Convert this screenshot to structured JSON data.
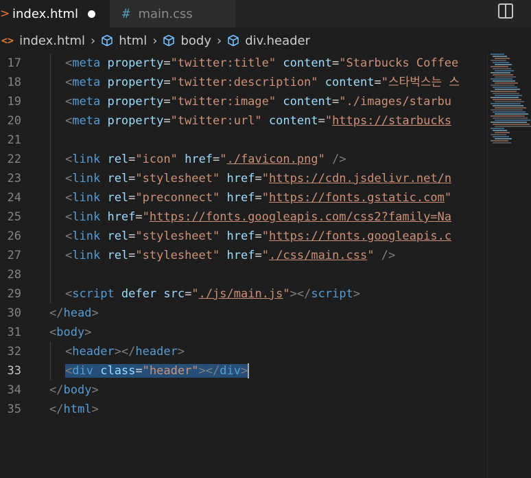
{
  "tabs": [
    {
      "label": "index.html",
      "icon": "html-chevron-icon",
      "active": true,
      "modified": true
    },
    {
      "label": "main.css",
      "icon": "hash-icon",
      "active": false
    }
  ],
  "breadcrumb": [
    "index.html",
    "html",
    "body",
    "div.header"
  ],
  "code_lines": [
    {
      "n": "17",
      "indent": 2,
      "tokens": [
        [
          "p",
          "<"
        ],
        [
          "tag",
          "meta"
        ],
        [
          "sp",
          " "
        ],
        [
          "attr",
          "property"
        ],
        [
          "eq",
          "="
        ],
        [
          "str",
          "\"twitter:title\""
        ],
        [
          "sp",
          " "
        ],
        [
          "attr",
          "content"
        ],
        [
          "eq",
          "="
        ],
        [
          "str",
          "\"Starbucks Coffee"
        ]
      ]
    },
    {
      "n": "18",
      "indent": 2,
      "tokens": [
        [
          "p",
          "<"
        ],
        [
          "tag",
          "meta"
        ],
        [
          "sp",
          " "
        ],
        [
          "attr",
          "property"
        ],
        [
          "eq",
          "="
        ],
        [
          "str",
          "\"twitter:description\""
        ],
        [
          "sp",
          " "
        ],
        [
          "attr",
          "content"
        ],
        [
          "eq",
          "="
        ],
        [
          "str",
          "\"스타벅스는 스"
        ]
      ]
    },
    {
      "n": "19",
      "indent": 2,
      "tokens": [
        [
          "p",
          "<"
        ],
        [
          "tag",
          "meta"
        ],
        [
          "sp",
          " "
        ],
        [
          "attr",
          "property"
        ],
        [
          "eq",
          "="
        ],
        [
          "str",
          "\"twitter:image\""
        ],
        [
          "sp",
          " "
        ],
        [
          "attr",
          "content"
        ],
        [
          "eq",
          "="
        ],
        [
          "str",
          "\"./images/starbu"
        ]
      ]
    },
    {
      "n": "20",
      "indent": 2,
      "tokens": [
        [
          "p",
          "<"
        ],
        [
          "tag",
          "meta"
        ],
        [
          "sp",
          " "
        ],
        [
          "attr",
          "property"
        ],
        [
          "eq",
          "="
        ],
        [
          "str",
          "\"twitter:url\""
        ],
        [
          "sp",
          " "
        ],
        [
          "attr",
          "content"
        ],
        [
          "eq",
          "="
        ],
        [
          "str",
          "\""
        ],
        [
          "url",
          "https://starbucks"
        ]
      ]
    },
    {
      "n": "21",
      "indent": 2,
      "tokens": []
    },
    {
      "n": "22",
      "indent": 2,
      "tokens": [
        [
          "p",
          "<"
        ],
        [
          "tag",
          "link"
        ],
        [
          "sp",
          " "
        ],
        [
          "attr",
          "rel"
        ],
        [
          "eq",
          "="
        ],
        [
          "str",
          "\"icon\""
        ],
        [
          "sp",
          " "
        ],
        [
          "attr",
          "href"
        ],
        [
          "eq",
          "="
        ],
        [
          "str",
          "\""
        ],
        [
          "url",
          "./favicon.png"
        ],
        [
          "str",
          "\""
        ],
        [
          "sp",
          " "
        ],
        [
          "p",
          "/>"
        ]
      ]
    },
    {
      "n": "23",
      "indent": 2,
      "tokens": [
        [
          "p",
          "<"
        ],
        [
          "tag",
          "link"
        ],
        [
          "sp",
          " "
        ],
        [
          "attr",
          "rel"
        ],
        [
          "eq",
          "="
        ],
        [
          "str",
          "\"stylesheet\""
        ],
        [
          "sp",
          " "
        ],
        [
          "attr",
          "href"
        ],
        [
          "eq",
          "="
        ],
        [
          "str",
          "\""
        ],
        [
          "url",
          "https://cdn.jsdelivr.net/n"
        ]
      ]
    },
    {
      "n": "24",
      "indent": 2,
      "tokens": [
        [
          "p",
          "<"
        ],
        [
          "tag",
          "link"
        ],
        [
          "sp",
          " "
        ],
        [
          "attr",
          "rel"
        ],
        [
          "eq",
          "="
        ],
        [
          "str",
          "\"preconnect\""
        ],
        [
          "sp",
          " "
        ],
        [
          "attr",
          "href"
        ],
        [
          "eq",
          "="
        ],
        [
          "str",
          "\""
        ],
        [
          "url",
          "https://fonts.gstatic.com"
        ],
        [
          "str",
          "\""
        ]
      ]
    },
    {
      "n": "25",
      "indent": 2,
      "tokens": [
        [
          "p",
          "<"
        ],
        [
          "tag",
          "link"
        ],
        [
          "sp",
          " "
        ],
        [
          "attr",
          "href"
        ],
        [
          "eq",
          "="
        ],
        [
          "str",
          "\""
        ],
        [
          "url",
          "https://fonts.googleapis.com/css2?family=Na"
        ]
      ]
    },
    {
      "n": "26",
      "indent": 2,
      "tokens": [
        [
          "p",
          "<"
        ],
        [
          "tag",
          "link"
        ],
        [
          "sp",
          " "
        ],
        [
          "attr",
          "rel"
        ],
        [
          "eq",
          "="
        ],
        [
          "str",
          "\"stylesheet\""
        ],
        [
          "sp",
          " "
        ],
        [
          "attr",
          "href"
        ],
        [
          "eq",
          "="
        ],
        [
          "str",
          "\""
        ],
        [
          "url",
          "https://fonts.googleapis.c"
        ]
      ]
    },
    {
      "n": "27",
      "indent": 2,
      "tokens": [
        [
          "p",
          "<"
        ],
        [
          "tag",
          "link"
        ],
        [
          "sp",
          " "
        ],
        [
          "attr",
          "rel"
        ],
        [
          "eq",
          "="
        ],
        [
          "str",
          "\"stylesheet\""
        ],
        [
          "sp",
          " "
        ],
        [
          "attr",
          "href"
        ],
        [
          "eq",
          "="
        ],
        [
          "str",
          "\""
        ],
        [
          "url",
          "./css/main.css"
        ],
        [
          "str",
          "\""
        ],
        [
          "sp",
          " "
        ],
        [
          "p",
          "/>"
        ]
      ]
    },
    {
      "n": "28",
      "indent": 2,
      "tokens": []
    },
    {
      "n": "29",
      "indent": 2,
      "tokens": [
        [
          "p",
          "<"
        ],
        [
          "tag",
          "script"
        ],
        [
          "sp",
          " "
        ],
        [
          "attr",
          "defer"
        ],
        [
          "sp",
          " "
        ],
        [
          "attr",
          "src"
        ],
        [
          "eq",
          "="
        ],
        [
          "str",
          "\""
        ],
        [
          "url",
          "./js/main.js"
        ],
        [
          "str",
          "\""
        ],
        [
          "p",
          "></"
        ],
        [
          "tag",
          "script"
        ],
        [
          "p",
          ">"
        ]
      ]
    },
    {
      "n": "30",
      "indent": 1,
      "tokens": [
        [
          "p",
          "</"
        ],
        [
          "tag",
          "head"
        ],
        [
          "p",
          ">"
        ]
      ]
    },
    {
      "n": "31",
      "indent": 1,
      "tokens": [
        [
          "p",
          "<"
        ],
        [
          "tag",
          "body"
        ],
        [
          "p",
          ">"
        ]
      ]
    },
    {
      "n": "32",
      "indent": 2,
      "tokens": [
        [
          "p",
          "<"
        ],
        [
          "tag",
          "header"
        ],
        [
          "p",
          "></"
        ],
        [
          "tag",
          "header"
        ],
        [
          "p",
          ">"
        ]
      ]
    },
    {
      "n": "33",
      "indent": 2,
      "current": true,
      "selected": true,
      "tokens": [
        [
          "p",
          "<"
        ],
        [
          "tag",
          "div"
        ],
        [
          "sp",
          " "
        ],
        [
          "attr",
          "class"
        ],
        [
          "eq",
          "="
        ],
        [
          "str",
          "\"header\""
        ],
        [
          "p",
          "></"
        ],
        [
          "tag",
          "div"
        ],
        [
          "p",
          ">"
        ]
      ]
    },
    {
      "n": "34",
      "indent": 1,
      "tokens": [
        [
          "p",
          "</"
        ],
        [
          "tag",
          "body"
        ],
        [
          "p",
          ">"
        ]
      ]
    },
    {
      "n": "35",
      "indent": 1,
      "tokens": [
        [
          "p",
          "</"
        ],
        [
          "tag",
          "html"
        ],
        [
          "p",
          ">"
        ]
      ]
    }
  ],
  "colors": {
    "tag": "#569cd6",
    "attr": "#9cdcfe",
    "string": "#ce9178",
    "punct": "#808080",
    "selection": "#264f78"
  }
}
